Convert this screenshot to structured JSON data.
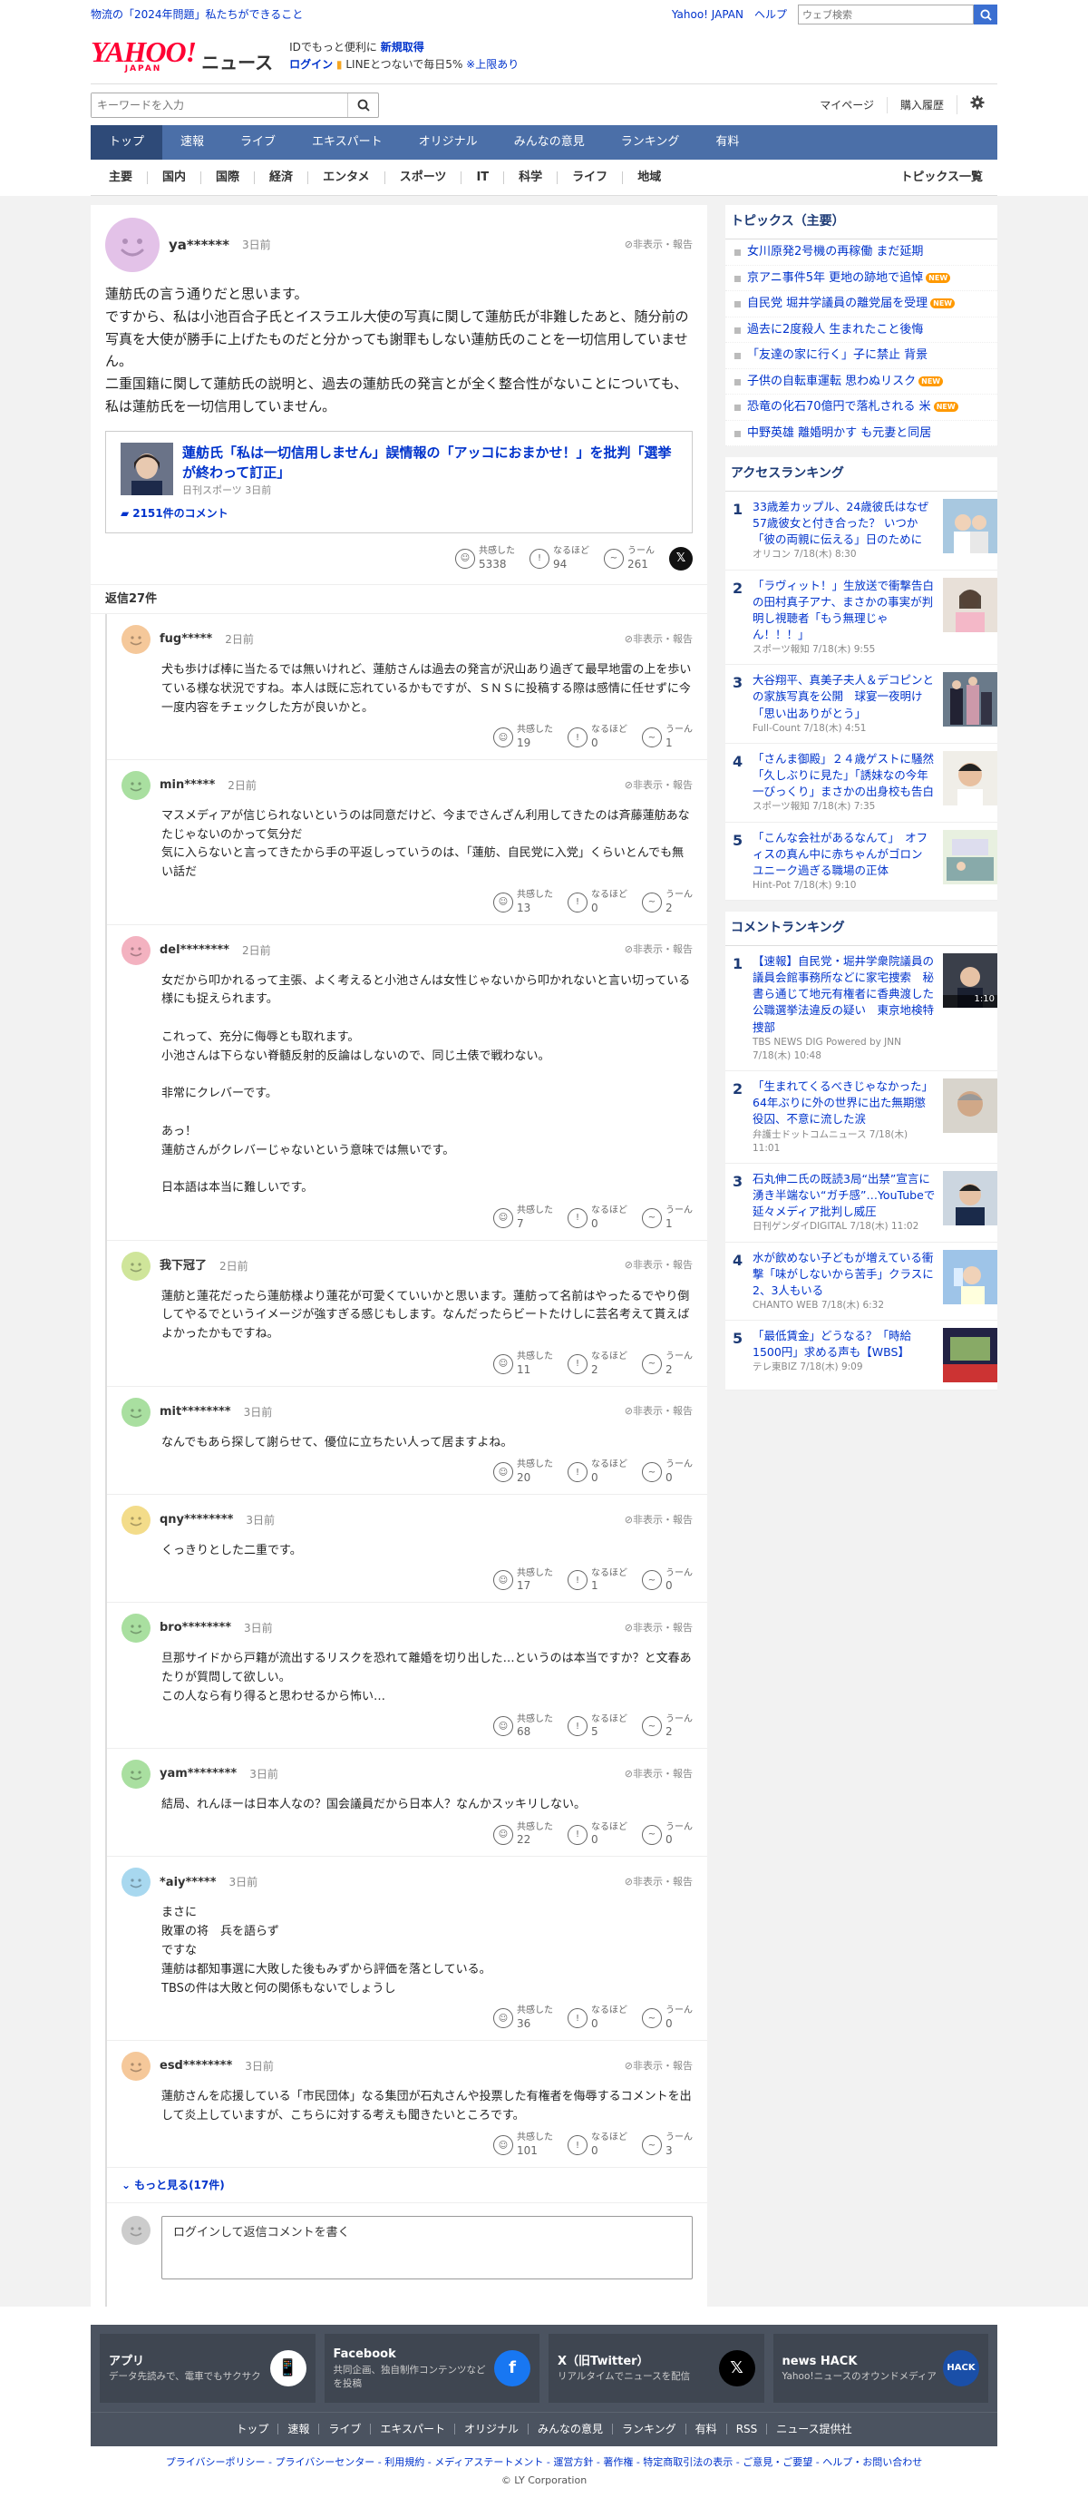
{
  "topbar": {
    "announce": "物流の「2024年問題」私たちができること",
    "yj": "Yahoo! JAPAN",
    "help": "ヘルプ",
    "search_placeholder": "ウェブ検索"
  },
  "header": {
    "logo": "YAHOO!",
    "logo_sub": "JAPAN",
    "news": "ニュース",
    "line1a": "IDでもっと便利に",
    "line1b": "新規取得",
    "line2a": "ログイン",
    "line2b": "LINEとつないで毎日5%",
    "line2c": "※上限あり"
  },
  "search": {
    "placeholder": "キーワードを入力",
    "mypage": "マイページ",
    "history": "購入履歴"
  },
  "gnav": [
    "トップ",
    "速報",
    "ライブ",
    "エキスパート",
    "オリジナル",
    "みんなの意見",
    "ランキング",
    "有料"
  ],
  "subnav": [
    "主要",
    "国内",
    "国際",
    "経済",
    "エンタメ",
    "スポーツ",
    "IT",
    "科学",
    "ライフ",
    "地域"
  ],
  "subnav_all": "トピックス一覧",
  "main_comment": {
    "user": "ya******",
    "time": "3日前",
    "report": "非表示・報告",
    "body": "蓮舫氏の言う通りだと思います。\nですから、私は小池百合子氏とイスラエル大使の写真に関して蓮舫氏が非難したあと、随分前の写真を大使が勝手に上げたものだと分かっても謝罪もしない蓮舫氏のことを一切信用していません。\n二重国籍に関して蓮舫氏の説明と、過去の蓮舫氏の発言とが全く整合性がないことについても、私は蓮舫氏を一切信用していません。",
    "article_title": "蓮舫氏「私は一切信用しません」誤情報の「アッコにおまかせ！」を批判「選挙が終わって訂正」",
    "article_src": "日刊スポーツ 3日前",
    "article_comments": "2151件のコメント",
    "r1": "共感した",
    "r1n": "5338",
    "r2": "なるほど",
    "r2n": "94",
    "r3": "うーん",
    "r3n": "261",
    "x": "𝕏"
  },
  "reply_count": "返信27件",
  "labels": {
    "r1": "共感した",
    "r2": "なるほど",
    "r3": "うーん",
    "report": "非表示・報告"
  },
  "replies": [
    {
      "user": "fug*****",
      "time": "2日前",
      "color": "#f5c89a",
      "body": "犬も歩けば棒に当たるでは無いけれど、蓮舫さんは過去の発言が沢山あり過ぎて最早地雷の上を歩いている様な状況ですね。本人は既に忘れているかもですが、ＳＮＳに投稿する際は感情に任せずに今一度内容をチェックした方が良いかと。",
      "n1": "19",
      "n2": "0",
      "n3": "1"
    },
    {
      "user": "min*****",
      "time": "2日前",
      "color": "#a9dfa0",
      "body": "マスメディアが信じられないというのは同意だけど、今までさんざん利用してきたのは斉藤蓮舫あなたじゃないのかって気分だ\n気に入らないと言ってきたから手の平返しっていうのは、「蓮舫、自民党に入党」くらいとんでも無い話だ",
      "n1": "13",
      "n2": "0",
      "n3": "2"
    },
    {
      "user": "del********",
      "time": "2日前",
      "color": "#f3b2c0",
      "body": "女だから叩かれるって主張、よく考えると小池さんは女性じゃないから叩かれないと言い切っている様にも捉えられます。\n\nこれって、充分に侮辱とも取れます。\n小池さんは下らない脊髄反射的反論はしないので、同じ土俵で戦わない。\n\n非常にクレバーです。\n\nあっ！\n蓮舫さんがクレバーじゃないという意味では無いです。\n\n日本語は本当に難しいです。",
      "n1": "7",
      "n2": "0",
      "n3": "1"
    },
    {
      "user": "我下冠了",
      "time": "2日前",
      "color": "#cfe59a",
      "body": "蓮舫と蓮花だったら蓮舫様より蓮花が可愛くていいかと思います。蓮舫って名前はやったるでやり倒してやるでというイメージが強すぎる感じもします。なんだったらビートたけしに芸名考えて貰えばよかったかもですね。",
      "n1": "11",
      "n2": "2",
      "n3": "2"
    },
    {
      "user": "mit********",
      "time": "3日前",
      "color": "#a9dfa0",
      "body": "なんでもあら探して謝らせて、優位に立ちたい人って居ますよね。",
      "n1": "20",
      "n2": "0",
      "n3": "0"
    },
    {
      "user": "qny********",
      "time": "3日前",
      "color": "#f3dc8a",
      "body": "くっきりとした二重です。",
      "n1": "17",
      "n2": "1",
      "n3": "0"
    },
    {
      "user": "bro********",
      "time": "3日前",
      "color": "#a9dfa0",
      "body": "旦那サイドから戸籍が流出するリスクを恐れて離婚を切り出した…というのは本当ですか？と文春あたりが質問して欲しい。\nこの人なら有り得ると思わせるから怖い…",
      "n1": "68",
      "n2": "5",
      "n3": "2"
    },
    {
      "user": "yam********",
      "time": "3日前",
      "color": "#a9dfa0",
      "body": "結局、れんほーは日本人なの？国会議員だから日本人？なんかスッキリしない。",
      "n1": "22",
      "n2": "0",
      "n3": "0"
    },
    {
      "user": "*aiy*****",
      "time": "3日前",
      "color": "#a8d8ef",
      "body": "まさに\n敗軍の将　兵を語らず\nですな\n蓮舫は都知事選に大敗した後もみずから評価を落としている。\nTBSの件は大敗と何の関係もないでしょうし",
      "n1": "36",
      "n2": "0",
      "n3": "0"
    },
    {
      "user": "esd********",
      "time": "3日前",
      "color": "#f5c89a",
      "body": "蓮舫さんを応援している「市民団体」なる集団が石丸さんや投票した有権者を侮辱するコメントを出して炎上していますが、こちらに対する考えも聞きたいところです。",
      "n1": "101",
      "n2": "0",
      "n3": "3"
    }
  ],
  "more": "もっと見る(17件)",
  "write_placeholder": "ログインして返信コメントを書く",
  "topics": {
    "title": "トピックス（主要）",
    "new": "NEW",
    "items": [
      {
        "t": "女川原発2号機の再稼働 まだ延期",
        "new": false
      },
      {
        "t": "京アニ事件5年 更地の跡地で追悼",
        "new": true
      },
      {
        "t": "自民党 堀井学議員の離党届を受理",
        "new": true
      },
      {
        "t": "過去に2度殺人 生まれたこと後悔",
        "new": false
      },
      {
        "t": "「友達の家に行く」子に禁止 背景",
        "new": false
      },
      {
        "t": "子供の自転車運転 思わぬリスク",
        "new": true
      },
      {
        "t": "恐竜の化石70億円で落札される 米",
        "new": true
      },
      {
        "t": "中野英雄 離婚明かす も元妻と同居",
        "new": false
      }
    ]
  },
  "access": {
    "title": "アクセスランキング",
    "items": [
      {
        "n": "1",
        "t": "33歳差カップル、24歳彼氏はなぜ57歳彼女と付き合った？ いつか「彼の両親に伝える」日のために",
        "s": "オリコン 7/18(木) 8:30"
      },
      {
        "n": "2",
        "t": "「ラヴィット！」生放送で衝撃告白の田村真子アナ、まさかの事実が判明し視聴者「もう無理じゃん！！！」",
        "s": "スポーツ報知 7/18(木) 9:55"
      },
      {
        "n": "3",
        "t": "大谷翔平、真美子夫人＆デコピンとの家族写真を公開　球宴一夜明け「思い出ありがとう」",
        "s": "Full-Count 7/18(木) 4:51"
      },
      {
        "n": "4",
        "t": "「さんま御殿」２４歳ゲストに騒然「久しぶりに見た」「誘妹なの今年一びっくり」まさかの出身校も告白",
        "s": "スポーツ報知 7/18(木) 7:35"
      },
      {
        "n": "5",
        "t": "「こんな会社があるなんて」　オフィスの真ん中に赤ちゃんがゴロン　ユニーク過ぎる職場の正体",
        "s": "Hint-Pot 7/18(木) 9:10"
      }
    ]
  },
  "comment_rank": {
    "title": "コメントランキング",
    "video": "1:10",
    "items": [
      {
        "n": "1",
        "t": "【速報】自民党・堀井学衆院議員の議員会館事務所などに家宅捜索　秘書ら通じて地元有権者に香典渡した公職選挙法違反の疑い　東京地検特捜部",
        "s": "TBS NEWS DIG Powered by JNN 7/18(木) 10:48"
      },
      {
        "n": "2",
        "t": "「生まれてくるべきじゃなかった」64年ぶりに外の世界に出た無期懲役囚、不意に流した涙",
        "s": "弁護士ドットコムニュース 7/18(木) 11:01"
      },
      {
        "n": "3",
        "t": "石丸伸二氏の既読3局“出禁”宣言に湧き半端ない“ガチ感”…YouTubeで延々メディア批判し威圧",
        "s": "日刊ゲンダイDIGITAL 7/18(木) 11:02"
      },
      {
        "n": "4",
        "t": "水が飲めない子どもが増えている衝撃「味がしないから苦手」クラスに2、3人もいる",
        "s": "CHANTO WEB 7/18(木) 6:32"
      },
      {
        "n": "5",
        "t": "「最低賃金」どうなる？「時給1500円」求める声も【WBS】",
        "s": "テレ東BIZ 7/18(木) 9:09"
      }
    ]
  },
  "footer": {
    "apps": [
      {
        "t": "アプリ",
        "d": "データ先読みで、電車でもサクサク",
        "ic": "📱"
      },
      {
        "t": "Facebook",
        "d": "共同企画、独自制作コンテンツなどを投稿",
        "ic": "f"
      },
      {
        "t": "X（旧Twitter）",
        "d": "リアルタイムでニュースを配信",
        "ic": "𝕏"
      },
      {
        "t": "news HACK",
        "d": "Yahoo!ニュースのオウンドメディア",
        "ic": "HACK"
      }
    ],
    "nav": [
      "トップ",
      "速報",
      "ライブ",
      "エキスパート",
      "オリジナル",
      "みんなの意見",
      "ランキング",
      "有料",
      "RSS",
      "ニュース提供社"
    ],
    "links": "プライバシーポリシー - プライバシーセンター - 利用規約 - メディアステートメント - 運営方針 - 著作権 - 特定商取引法の表示 - ご意見・ご要望 - ヘルプ・お問い合わせ",
    "copy": "© LY Corporation"
  }
}
